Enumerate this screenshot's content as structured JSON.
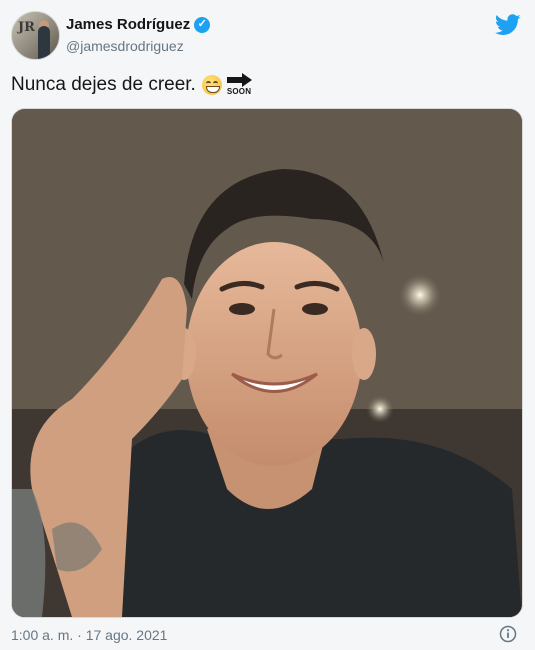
{
  "user": {
    "display_name": "James Rodríguez",
    "handle": "@jamesdrodriguez",
    "verified": true,
    "verified_glyph": "✓"
  },
  "tweet": {
    "text": "Nunca dejes de creer.",
    "emojis": [
      "grinning-face-emoji",
      "soon-arrow-emoji"
    ],
    "soon_label": "SOON",
    "photo": "selfie-photo"
  },
  "meta": {
    "timestamp": "1:00 a. m. · 17 ago. 2021"
  },
  "icons": {
    "twitter": "twitter-bird-icon",
    "info": "info-icon"
  },
  "colors": {
    "brand": "#1da1f2",
    "text": "#14171a",
    "secondary": "#657786"
  }
}
